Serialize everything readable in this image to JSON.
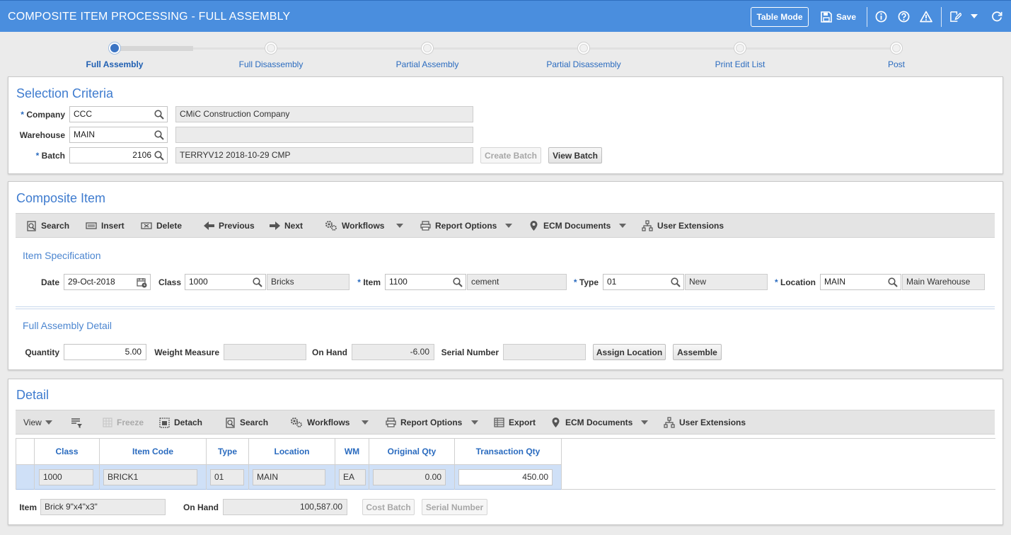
{
  "header": {
    "title": "COMPOSITE ITEM PROCESSING - FULL ASSEMBLY",
    "table_mode": "Table Mode",
    "save": "Save"
  },
  "steps": [
    {
      "label": "Full Assembly",
      "active": true
    },
    {
      "label": "Full Disassembly",
      "active": false
    },
    {
      "label": "Partial Assembly",
      "active": false
    },
    {
      "label": "Partial Disassembly",
      "active": false
    },
    {
      "label": "Print Edit List",
      "active": false
    },
    {
      "label": "Post",
      "active": false
    }
  ],
  "selection": {
    "title": "Selection Criteria",
    "company_label": "Company",
    "company_value": "CCC",
    "company_name": "CMiC Construction Company",
    "warehouse_label": "Warehouse",
    "warehouse_value": "MAIN",
    "warehouse_name": "",
    "batch_label": "Batch",
    "batch_value": "2106",
    "batch_name": "TERRYV12 2018-10-29 CMP",
    "create_batch": "Create Batch",
    "view_batch": "View Batch"
  },
  "composite": {
    "title": "Composite Item",
    "toolbar": {
      "search": "Search",
      "insert": "Insert",
      "delete": "Delete",
      "previous": "Previous",
      "next": "Next",
      "workflows": "Workflows",
      "report_options": "Report Options",
      "ecm_documents": "ECM Documents",
      "user_extensions": "User Extensions"
    },
    "spec_title": "Item Specification",
    "date_label": "Date",
    "date_value": "29-Oct-2018",
    "class_label": "Class",
    "class_value": "1000",
    "class_name": "Bricks",
    "item_label": "Item",
    "item_value": "1100",
    "item_name": "cement",
    "type_label": "Type",
    "type_value": "01",
    "type_name": "New",
    "location_label": "Location",
    "location_value": "MAIN",
    "location_name": "Main Warehouse",
    "detail_title": "Full Assembly Detail",
    "quantity_label": "Quantity",
    "quantity_value": "5.00",
    "weight_label": "Weight Measure",
    "weight_value": "",
    "onhand_label": "On Hand",
    "onhand_value": "-6.00",
    "serial_label": "Serial Number",
    "serial_value": "",
    "assign_location": "Assign Location",
    "assemble": "Assemble"
  },
  "detail": {
    "title": "Detail",
    "toolbar": {
      "view": "View",
      "freeze": "Freeze",
      "detach": "Detach",
      "search": "Search",
      "workflows": "Workflows",
      "report_options": "Report Options",
      "export": "Export",
      "ecm_documents": "ECM Documents",
      "user_extensions": "User Extensions"
    },
    "columns": [
      "Class",
      "Item Code",
      "Type",
      "Location",
      "WM",
      "Original Qty",
      "Transaction Qty"
    ],
    "rows": [
      {
        "class": "1000",
        "item_code": "BRICK1",
        "type": "01",
        "location": "MAIN",
        "wm": "EA",
        "original_qty": "0.00",
        "transaction_qty": "450.00"
      }
    ],
    "item_label": "Item",
    "item_value": "Brick 9\"x4\"x3\"",
    "onhand_label": "On Hand",
    "onhand_value": "100,587.00",
    "cost_batch": "Cost Batch",
    "serial_number": "Serial Number"
  },
  "colors": {
    "header_bg": "#4a8ede",
    "accent": "#3f7ccf",
    "row_selected": "#cfe0f7"
  }
}
